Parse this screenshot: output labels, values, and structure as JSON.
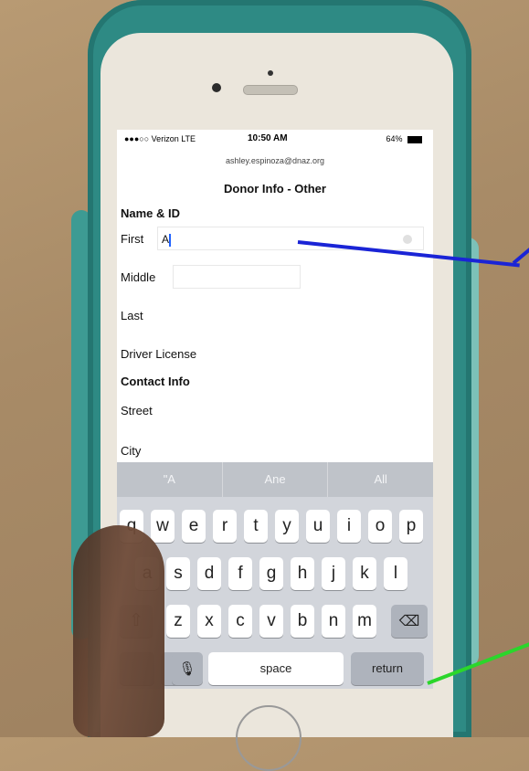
{
  "status_bar": {
    "carrier": "●●●○○ Verizon  LTE",
    "time": "10:50 AM",
    "battery": "64%"
  },
  "account_email": "ashley.espinoza@dnaz.org",
  "page_title": "Donor Info - Other",
  "sections": {
    "name_id": "Name & ID",
    "contact_info": "Contact Info"
  },
  "fields": {
    "first": {
      "label": "First",
      "value": "A"
    },
    "middle": {
      "label": "Middle",
      "value": ""
    },
    "last": {
      "label": "Last",
      "value": ""
    },
    "driver_license": {
      "label": "Driver License",
      "value": ""
    },
    "street": {
      "label": "Street",
      "value": ""
    },
    "city": {
      "label": "City",
      "value": ""
    }
  },
  "keyboard": {
    "suggestions": [
      "\"A",
      "Ane",
      "All"
    ],
    "row1": [
      "q",
      "w",
      "e",
      "r",
      "t",
      "y",
      "u",
      "i",
      "o",
      "p"
    ],
    "row2": [
      "a",
      "s",
      "d",
      "f",
      "g",
      "h",
      "j",
      "k",
      "l"
    ],
    "row3": [
      "z",
      "x",
      "c",
      "v",
      "b",
      "n",
      "m"
    ],
    "space_label": "space",
    "return_label": "return"
  },
  "colors": {
    "case": "#2e8a84",
    "annotation_blue": "#1a24d6",
    "annotation_green": "#2bd62b",
    "caret": "#1f62ff"
  }
}
